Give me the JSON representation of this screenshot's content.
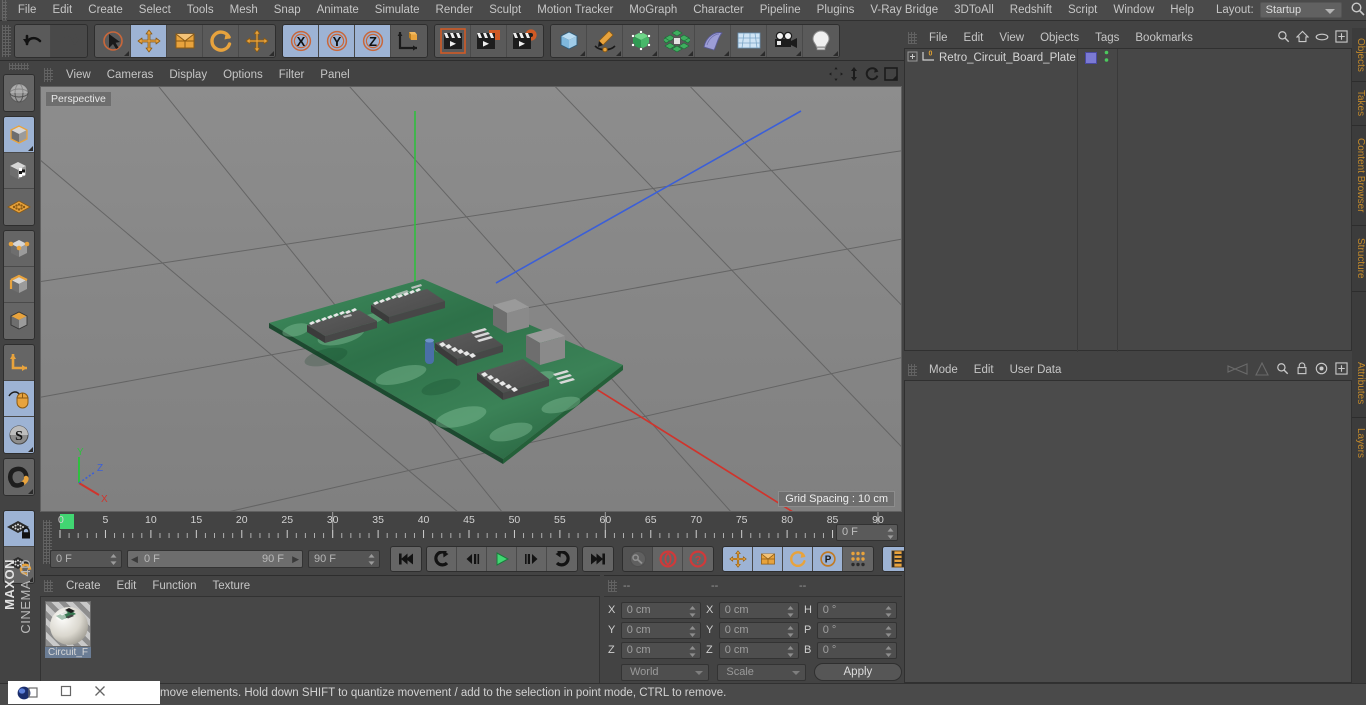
{
  "app": {
    "name": "MAXON CINEMA 4D",
    "brand_top": "MAXON",
    "brand_bottom": "CINEMA 4D"
  },
  "menubar": {
    "items": [
      "File",
      "Edit",
      "Create",
      "Select",
      "Tools",
      "Mesh",
      "Snap",
      "Animate",
      "Simulate",
      "Render",
      "Sculpt",
      "Motion Tracker",
      "MoGraph",
      "Character",
      "Pipeline",
      "Plugins",
      "V-Ray Bridge",
      "3DToAll",
      "Redshift",
      "Script",
      "Window",
      "Help"
    ],
    "layout_label": "Layout:",
    "layout_value": "Startup",
    "search_icon": "search-icon"
  },
  "toolbar": {
    "groups": [
      {
        "name": "undo-redo",
        "buttons": [
          {
            "name": "undo-button",
            "icon": "undo-arrow-icon",
            "state": "off"
          },
          {
            "name": "redo-button",
            "icon": "redo-arrow-icon",
            "state": "disabled"
          }
        ]
      },
      {
        "name": "transform-tools",
        "buttons": [
          {
            "name": "live-selection-tool",
            "icon": "cursor-circle-icon",
            "state": "off"
          },
          {
            "name": "move-tool",
            "icon": "move-arrows-icon",
            "state": "on"
          },
          {
            "name": "scale-tool",
            "icon": "scale-box-icon",
            "state": "off"
          },
          {
            "name": "rotate-tool",
            "icon": "rotate-arc-icon",
            "state": "off"
          },
          {
            "name": "move-alt-tool",
            "icon": "move-arrows-icon",
            "state": "off"
          }
        ]
      },
      {
        "name": "axis-locks",
        "buttons": [
          {
            "name": "lock-x-axis-button",
            "icon": "x-axis-icon",
            "label": "X",
            "state": "on"
          },
          {
            "name": "lock-y-axis-button",
            "icon": "y-axis-icon",
            "label": "Y",
            "state": "on"
          },
          {
            "name": "lock-z-axis-button",
            "icon": "z-axis-icon",
            "label": "Z",
            "state": "on"
          },
          {
            "name": "world-object-coord-button",
            "icon": "world-axis-cube-icon",
            "state": "off"
          }
        ]
      },
      {
        "name": "render-tools",
        "buttons": [
          {
            "name": "render-view-button",
            "icon": "clapperboard-icon",
            "state": "off"
          },
          {
            "name": "render-to-picture-viewer-button",
            "icon": "clapperboard-window-icon",
            "state": "off"
          },
          {
            "name": "render-settings-button",
            "icon": "clapperboard-gear-icon",
            "state": "off"
          }
        ]
      },
      {
        "name": "object-creation",
        "buttons": [
          {
            "name": "add-cube-button",
            "icon": "cube-icon",
            "state": "off"
          },
          {
            "name": "add-spline-button",
            "icon": "pen-spline-icon",
            "state": "off"
          },
          {
            "name": "add-nurbs-button",
            "icon": "green-cube-nurbs-icon",
            "state": "off"
          },
          {
            "name": "add-array-button",
            "icon": "green-cluster-icon",
            "state": "off"
          },
          {
            "name": "add-deformer-button",
            "icon": "bend-deformer-icon",
            "state": "off"
          },
          {
            "name": "add-environment-button",
            "icon": "floor-grid-icon",
            "state": "off"
          },
          {
            "name": "add-camera-button",
            "icon": "camera-icon",
            "state": "off"
          },
          {
            "name": "add-light-button",
            "icon": "lightbulb-icon",
            "state": "off"
          }
        ]
      }
    ]
  },
  "lefttool": {
    "groups": [
      {
        "buttons": [
          {
            "name": "undo-view-button",
            "icon": "globe-sphere-icon",
            "state": "off"
          }
        ]
      },
      {
        "buttons": [
          {
            "name": "model-mode-button",
            "icon": "grey-cube-icon",
            "state": "on"
          },
          {
            "name": "texture-mode-button",
            "icon": "checker-cube-icon",
            "state": "off"
          },
          {
            "name": "workplane-mode-button",
            "icon": "orange-grid-icon",
            "state": "off"
          }
        ]
      },
      {
        "buttons": [
          {
            "name": "point-mode-button",
            "icon": "point-cube-icon",
            "state": "off"
          },
          {
            "name": "edge-mode-button",
            "icon": "edge-cube-icon",
            "state": "off"
          },
          {
            "name": "polygon-mode-button",
            "icon": "polygon-cube-icon",
            "state": "off"
          }
        ]
      },
      {
        "buttons": [
          {
            "name": "object-axis-mode-button",
            "icon": "axis-corner-icon",
            "state": "off"
          },
          {
            "name": "enable-axis-modification-button",
            "icon": "mouse-icon",
            "state": "on"
          },
          {
            "name": "snap-mode-button",
            "icon": "s-sphere-icon",
            "state": "on"
          }
        ]
      },
      {
        "buttons": [
          {
            "name": "magnet-tool-button",
            "icon": "magnet-icon",
            "state": "off"
          }
        ]
      },
      {
        "buttons": [
          {
            "name": "workplane-lock-button",
            "icon": "grid-lock-icon",
            "state": "on"
          },
          {
            "name": "workplane-rotate-button",
            "icon": "grid-rotate-icon",
            "state": "off"
          }
        ]
      }
    ]
  },
  "viewport": {
    "menu": [
      "View",
      "Cameras",
      "Display",
      "Options",
      "Filter",
      "Panel"
    ],
    "corner_icons": [
      "pan-icon",
      "dolly-icon",
      "rotate-icon",
      "maximize-icon"
    ],
    "label": "Perspective",
    "grid_spacing": "Grid Spacing : 10 cm",
    "axis_gizmo": {
      "x": "X",
      "y": "Y",
      "z": "Z"
    },
    "scene_object": "Retro Circuit Board Plate"
  },
  "timeline": {
    "ticks": [
      0,
      5,
      10,
      15,
      20,
      25,
      30,
      35,
      40,
      45,
      50,
      55,
      60,
      65,
      70,
      75,
      80,
      85,
      90
    ],
    "current_frame_marker": "0",
    "frame_field": "0 F",
    "start_field": "0 F",
    "range_start": "0 F",
    "range_end": "90 F",
    "end_field": "90 F",
    "transport": [
      {
        "name": "go-to-start-button",
        "icon": "skip-start-icon"
      },
      {
        "name": "previous-keyframe-button",
        "icon": "prev-key-icon"
      },
      {
        "name": "step-back-button",
        "icon": "step-back-icon"
      },
      {
        "name": "play-button",
        "icon": "play-icon"
      },
      {
        "name": "step-forward-button",
        "icon": "step-forward-icon"
      },
      {
        "name": "next-keyframe-button",
        "icon": "next-key-icon"
      },
      {
        "name": "go-to-end-button",
        "icon": "skip-end-icon"
      },
      {
        "name": "record-active-objects-button",
        "icon": "key-icon"
      },
      {
        "name": "autokeying-button",
        "icon": "auto-key-circle-icon"
      },
      {
        "name": "keyframe-selection-button",
        "icon": "question-circle-icon"
      },
      {
        "name": "position-key-button",
        "icon": "move-arrows-icon"
      },
      {
        "name": "scale-key-button",
        "icon": "scale-box-icon"
      },
      {
        "name": "rotation-key-button",
        "icon": "rotate-arc-icon"
      },
      {
        "name": "parameter-key-button",
        "icon": "p-circle-icon"
      },
      {
        "name": "point-level-animation-button",
        "icon": "dots-grid-icon"
      },
      {
        "name": "timeline-filmstrip-button",
        "icon": "filmstrip-icon"
      }
    ]
  },
  "material_manager": {
    "menu": [
      "Create",
      "Edit",
      "Function",
      "Texture"
    ],
    "materials": [
      {
        "name": "Circuit_F",
        "thumb": "sphere-preview"
      }
    ]
  },
  "coordinates": {
    "headers": [
      "--",
      "--",
      "--"
    ],
    "rows": [
      {
        "pos_label": "X",
        "pos_value": "0 cm",
        "size_label": "X",
        "size_value": "0 cm",
        "rot_label": "H",
        "rot_value": "0 °"
      },
      {
        "pos_label": "Y",
        "pos_value": "0 cm",
        "size_label": "Y",
        "size_value": "0 cm",
        "rot_label": "P",
        "rot_value": "0 °"
      },
      {
        "pos_label": "Z",
        "pos_value": "0 cm",
        "size_label": "Z",
        "size_value": "0 cm",
        "rot_label": "B",
        "rot_value": "0 °"
      }
    ],
    "coord_system": "World",
    "size_mode": "Scale",
    "apply_label": "Apply"
  },
  "object_manager": {
    "menu": [
      "File",
      "Edit",
      "View",
      "Objects",
      "Tags",
      "Bookmarks"
    ],
    "icons": [
      "search-icon",
      "home-icon",
      "ellipse-icon",
      "plus-box-icon"
    ],
    "objects": [
      {
        "name": "Retro_Circuit_Board_Plate",
        "layer_badge": "0",
        "tag_color": "#7b7ad4",
        "expandable": true
      }
    ]
  },
  "attribute_manager": {
    "menu": [
      "Mode",
      "Edit",
      "User Data"
    ],
    "icons": [
      "back-history-icon",
      "forward-history-icon",
      "search-icon",
      "lock-icon",
      "target-icon",
      "plus-box-icon"
    ],
    "content": ""
  },
  "right_dock_tabs": [
    "Objects",
    "Takes",
    "Content Browser",
    "Structure",
    "Attributes",
    "Layers"
  ],
  "statusbar": {
    "message": "move elements. Hold down SHIFT to quantize movement / add to the selection in point mode, CTRL to remove."
  },
  "taskbar": {
    "app_icon": "c4d-orb-icon",
    "restore_icon": "restore-window-icon",
    "minimize_icon": "minimize-icon",
    "close_icon": "close-icon"
  },
  "colors": {
    "accent_orange": "#e8a33d",
    "selected_blue": "#9db3d4",
    "axis_x": "#d0342c",
    "axis_y": "#2fbf3f",
    "axis_z": "#3b5fd8",
    "pcb_green": "#2f7a4e",
    "play_green": "#41d672",
    "panel_bg": "#434343"
  }
}
